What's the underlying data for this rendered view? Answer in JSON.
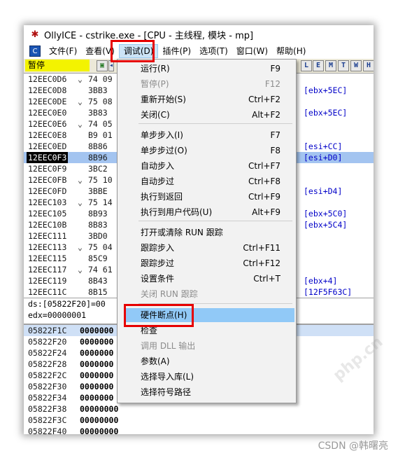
{
  "window": {
    "title": "OllyICE - cstrike.exe - [CPU - 主线程, 模块 - mp]"
  },
  "menubar": {
    "icon": "C",
    "items": [
      "文件(F)",
      "查看(V)",
      "调试(D)",
      "插件(P)",
      "选项(T)",
      "窗口(W)",
      "帮助(H)"
    ],
    "active_index": 2
  },
  "toolbar": {
    "status": "暂停",
    "right_buttons": [
      "E",
      "M",
      "T",
      "W",
      "H"
    ]
  },
  "cpu_rows": [
    {
      "addr": "12EEC0D6",
      "mark": "⌄",
      "hex": "74 09",
      "comment": ""
    },
    {
      "addr": "12EEC0D8",
      "mark": "",
      "hex": "3BB3",
      "comment": "[ebx+5EC]"
    },
    {
      "addr": "12EEC0DE",
      "mark": "⌄",
      "hex": "75 08",
      "comment": ""
    },
    {
      "addr": "12EEC0E0",
      "mark": "",
      "hex": "3B83",
      "comment": "[ebx+5EC]"
    },
    {
      "addr": "12EEC0E6",
      "mark": "⌄",
      "hex": "74 05",
      "comment": ""
    },
    {
      "addr": "12EEC0E8",
      "mark": "",
      "hex": "B9 01",
      "comment": ""
    },
    {
      "addr": "12EEC0ED",
      "mark": "",
      "hex": "8B86",
      "comment": "[esi+CC]"
    },
    {
      "addr": "12EEC0F3",
      "mark": "",
      "hex": "8B96",
      "comment": "[esi+D0]"
    },
    {
      "addr": "12EEC0F9",
      "mark": "",
      "hex": "3BC2",
      "comment": ""
    },
    {
      "addr": "12EEC0FB",
      "mark": "⌄",
      "hex": "75 10",
      "comment": ""
    },
    {
      "addr": "12EEC0FD",
      "mark": "",
      "hex": "3BBE",
      "comment": "[esi+D4]"
    },
    {
      "addr": "12EEC103",
      "mark": "⌄",
      "hex": "75 14",
      "comment": ""
    },
    {
      "addr": "12EEC105",
      "mark": "",
      "hex": "8B93",
      "comment": "[ebx+5C0]"
    },
    {
      "addr": "12EEC10B",
      "mark": "",
      "hex": "8B83",
      "comment": "[ebx+5C4]"
    },
    {
      "addr": "12EEC111",
      "mark": "",
      "hex": "3BD0",
      "comment": ""
    },
    {
      "addr": "12EEC113",
      "mark": "⌄",
      "hex": "75 04",
      "comment": ""
    },
    {
      "addr": "12EEC115",
      "mark": "",
      "hex": "85C9",
      "comment": ""
    },
    {
      "addr": "12EEC117",
      "mark": "⌄",
      "hex": "74 61",
      "comment": ""
    },
    {
      "addr": "12EEC119",
      "mark": "",
      "hex": "8B43",
      "comment": "[ebx+4]"
    },
    {
      "addr": "12EEC11C",
      "mark": "",
      "hex": "8B15",
      "comment": "[12F5F63C]"
    }
  ],
  "info": {
    "line1": "ds:[05822F20]=00",
    "line2": "edx=00000001"
  },
  "dump_rows": [
    {
      "addr": "05822F1C",
      "val": "0000000"
    },
    {
      "addr": "05822F20",
      "val": "0000000"
    },
    {
      "addr": "05822F24",
      "val": "0000000"
    },
    {
      "addr": "05822F28",
      "val": "0000000"
    },
    {
      "addr": "05822F2C",
      "val": "0000000"
    },
    {
      "addr": "05822F30",
      "val": "0000000"
    },
    {
      "addr": "05822F34",
      "val": "0000000"
    },
    {
      "addr": "05822F38",
      "val": "00000000"
    },
    {
      "addr": "05822F3C",
      "val": "00000000"
    },
    {
      "addr": "05822F40",
      "val": "00000000"
    }
  ],
  "debug_menu": {
    "items": [
      {
        "label": "运行(R)",
        "shortcut": "F9",
        "enabled": true
      },
      {
        "label": "暂停(P)",
        "shortcut": "F12",
        "enabled": false
      },
      {
        "label": "重新开始(S)",
        "shortcut": "Ctrl+F2",
        "enabled": true
      },
      {
        "label": "关闭(C)",
        "shortcut": "Alt+F2",
        "enabled": true
      },
      {
        "label": "单步步入(I)",
        "shortcut": "F7",
        "enabled": true
      },
      {
        "label": "单步步过(O)",
        "shortcut": "F8",
        "enabled": true
      },
      {
        "label": "自动步入",
        "shortcut": "Ctrl+F7",
        "enabled": true
      },
      {
        "label": "自动步过",
        "shortcut": "Ctrl+F8",
        "enabled": true
      },
      {
        "label": "执行到返回",
        "shortcut": "Ctrl+F9",
        "enabled": true
      },
      {
        "label": "执行到用户代码(U)",
        "shortcut": "Alt+F9",
        "enabled": true
      },
      {
        "label": "打开或清除 RUN 跟踪",
        "shortcut": "",
        "enabled": true
      },
      {
        "label": "跟踪步入",
        "shortcut": "Ctrl+F11",
        "enabled": true
      },
      {
        "label": "跟踪步过",
        "shortcut": "Ctrl+F12",
        "enabled": true
      },
      {
        "label": "设置条件",
        "shortcut": "Ctrl+T",
        "enabled": true
      },
      {
        "label": "关闭 RUN 跟踪",
        "shortcut": "",
        "enabled": false
      },
      {
        "label": "硬件断点(H)",
        "shortcut": "",
        "enabled": true
      },
      {
        "label": "检查",
        "shortcut": "",
        "enabled": true
      },
      {
        "label": "调用 DLL 输出",
        "shortcut": "",
        "enabled": false
      },
      {
        "label": "参数(A)",
        "shortcut": "",
        "enabled": true
      },
      {
        "label": "选择导入库(L)",
        "shortcut": "",
        "enabled": true
      },
      {
        "label": "选择符号路径",
        "shortcut": "",
        "enabled": true
      }
    ],
    "highlighted_index": 15
  },
  "credit": "CSDN @韩曙亮",
  "colors": {
    "highlight_border": "#e60000",
    "menu_highlight": "#91c9f7",
    "status_yellow": "#f3f300"
  }
}
